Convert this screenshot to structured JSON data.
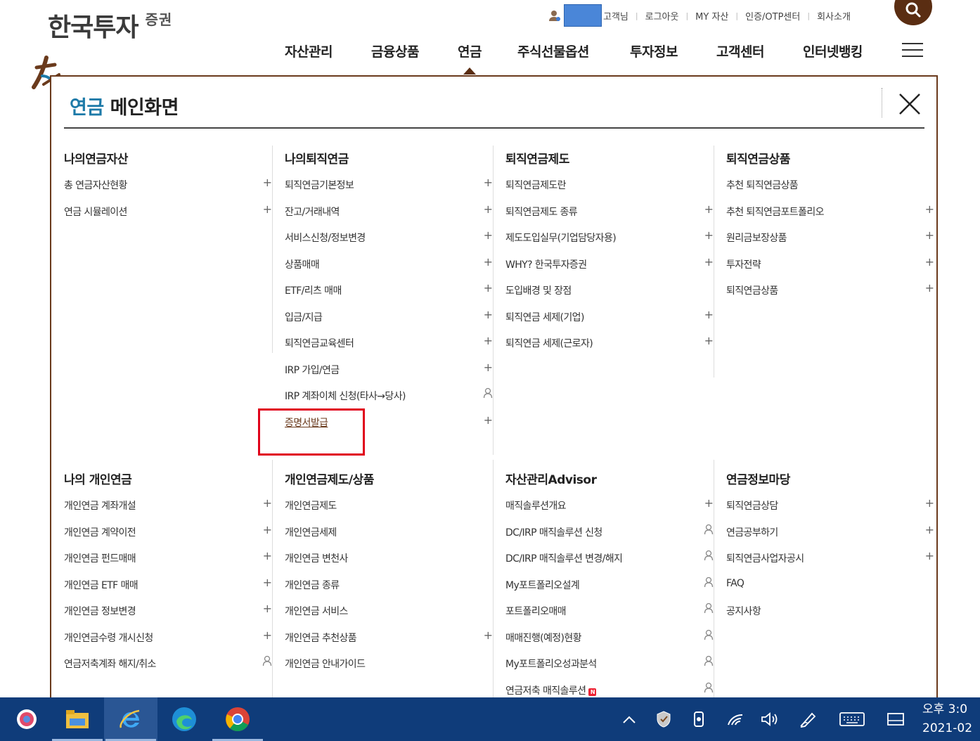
{
  "header": {
    "logo_main": "한국투자",
    "logo_sub": "증권",
    "util_links": {
      "greeting": "고객님",
      "logout": "로그아웃",
      "my_assets": "MY 자산",
      "otp": "인증/OTP센터",
      "company": "회사소개"
    },
    "gnb": [
      "자산관리",
      "금융상품",
      "연금",
      "주식선물옵션",
      "투자정보",
      "고객센터",
      "인터넷뱅킹"
    ],
    "active_gnb": "연금",
    "colors": {
      "brand": "#5a2d12",
      "accent": "#1d7aa8"
    }
  },
  "panel": {
    "title_accent": "연금",
    "title_rest": " 메인화면",
    "sections": {
      "s1": {
        "title": "나의연금자산",
        "items": [
          {
            "label": "총 연금자산현황",
            "mark": "+"
          },
          {
            "label": "연금 시뮬레이션",
            "mark": "+"
          }
        ]
      },
      "s2": {
        "title": "나의퇴직연금",
        "items": [
          {
            "label": "퇴직연금기본정보",
            "mark": "+"
          },
          {
            "label": "잔고/거래내역",
            "mark": "+"
          },
          {
            "label": "서비스신청/정보변경",
            "mark": "+"
          },
          {
            "label": "상품매매",
            "mark": "+"
          },
          {
            "label": "ETF/리츠 매매",
            "mark": "+"
          },
          {
            "label": "입금/지급",
            "mark": "+"
          },
          {
            "label": "퇴직연금교육센터",
            "mark": "+"
          },
          {
            "label": "IRP 가입/연금",
            "mark": "+"
          },
          {
            "label": "IRP 계좌이체 신청(타사→당사)",
            "mark": "lock"
          },
          {
            "label": "증명서발급",
            "mark": "+"
          }
        ]
      },
      "s3": {
        "title": "퇴직연금제도",
        "items": [
          {
            "label": "퇴직연금제도란",
            "mark": ""
          },
          {
            "label": "퇴직연금제도 종류",
            "mark": "+"
          },
          {
            "label": "제도도입실무(기업담당자용)",
            "mark": "+"
          },
          {
            "label": "WHY? 한국투자증권",
            "mark": "+"
          },
          {
            "label": "도입배경 및 장점",
            "mark": ""
          },
          {
            "label": "퇴직연금 세제(기업)",
            "mark": "+"
          },
          {
            "label": "퇴직연금 세제(근로자)",
            "mark": "+"
          }
        ]
      },
      "s4": {
        "title": "퇴직연금상품",
        "items": [
          {
            "label": "추천 퇴직연금상품",
            "mark": ""
          },
          {
            "label": "추천 퇴직연금포트폴리오",
            "mark": "+"
          },
          {
            "label": "원리금보장상품",
            "mark": "+"
          },
          {
            "label": "투자전략",
            "mark": "+"
          },
          {
            "label": "퇴직연금상품",
            "mark": "+"
          }
        ]
      },
      "s5": {
        "title": "나의 개인연금",
        "items": [
          {
            "label": "개인연금 계좌개설",
            "mark": "+"
          },
          {
            "label": "개인연금 계약이전",
            "mark": "+"
          },
          {
            "label": "개인연금 펀드매매",
            "mark": "+"
          },
          {
            "label": "개인연금 ETF 매매",
            "mark": "+"
          },
          {
            "label": "개인연금 정보변경",
            "mark": "+"
          },
          {
            "label": "개인연금수령 개시신청",
            "mark": "+"
          },
          {
            "label": "연금저축계좌 해지/취소",
            "mark": "lock"
          }
        ]
      },
      "s6": {
        "title": "개인연금제도/상품",
        "items": [
          {
            "label": "개인연금제도",
            "mark": ""
          },
          {
            "label": "개인연금세제",
            "mark": ""
          },
          {
            "label": "개인연금 변천사",
            "mark": ""
          },
          {
            "label": "개인연금 종류",
            "mark": ""
          },
          {
            "label": "개인연금 서비스",
            "mark": ""
          },
          {
            "label": "개인연금 추천상품",
            "mark": "+"
          },
          {
            "label": "개인연금 안내가이드",
            "mark": ""
          }
        ]
      },
      "s7": {
        "title": "자산관리Advisor",
        "items": [
          {
            "label": "매직솔루션개요",
            "mark": "+"
          },
          {
            "label": "DC/IRP 매직솔루션 신청",
            "mark": "lock"
          },
          {
            "label": "DC/IRP 매직솔루션 변경/해지",
            "mark": "lock"
          },
          {
            "label": "My포트폴리오설계",
            "mark": "lock"
          },
          {
            "label": "포트폴리오매매",
            "mark": "lock"
          },
          {
            "label": "매매진행(예정)현황",
            "mark": "lock"
          },
          {
            "label": "My포트폴리오성과분석",
            "mark": "lock"
          },
          {
            "label": "연금저축 매직솔루션",
            "mark": "lock"
          }
        ]
      },
      "s8": {
        "title": "연금정보마당",
        "items": [
          {
            "label": "퇴직연금상담",
            "mark": "+"
          },
          {
            "label": "연금공부하기",
            "mark": "+"
          },
          {
            "label": "퇴직연금사업자공시",
            "mark": "+"
          },
          {
            "label": "FAQ",
            "mark": ""
          },
          {
            "label": "공지사항",
            "mark": ""
          }
        ]
      }
    }
  },
  "taskbar": {
    "clock_time": "오후 3:0",
    "clock_date": "2021-02"
  }
}
